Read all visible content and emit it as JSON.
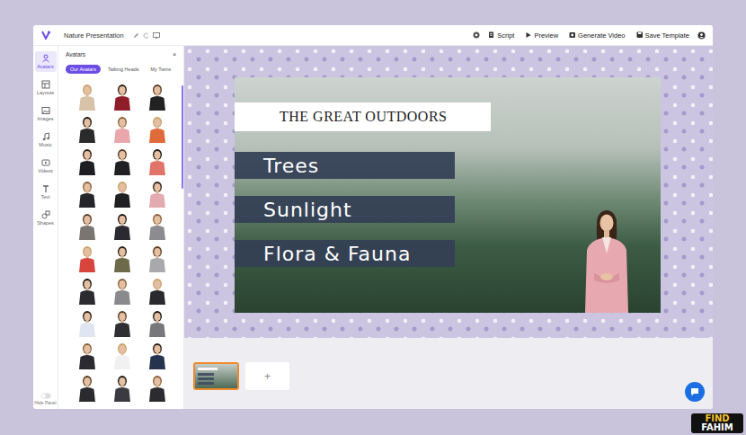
{
  "app": {
    "title": "Nature Presentation"
  },
  "toolbar": {
    "buttons": [
      "Script",
      "Preview",
      "Generate Video",
      "Save Template"
    ]
  },
  "rail": [
    {
      "label": "Avatars",
      "selected": true
    },
    {
      "label": "Layouts",
      "selected": false
    },
    {
      "label": "Images",
      "selected": false
    },
    {
      "label": "Music",
      "selected": false
    },
    {
      "label": "Videos",
      "selected": false
    },
    {
      "label": "Text",
      "selected": false
    },
    {
      "label": "Shapes",
      "selected": false
    }
  ],
  "rail_footer": "Hide Panel",
  "panel": {
    "title": "Avatars",
    "close": "×",
    "tabs": [
      {
        "label": "Our Avatars",
        "selected": true
      },
      {
        "label": "Talking Heads",
        "selected": false
      },
      {
        "label": "My Twins",
        "selected": false
      }
    ],
    "avatars": [
      {
        "color": "#d8c3a8"
      },
      {
        "color": "#8e1f2a"
      },
      {
        "color": "#222222"
      },
      {
        "color": "#2a2a2a"
      },
      {
        "color": "#e9a6ad"
      },
      {
        "color": "#e06b3a"
      },
      {
        "color": "#1e1e22"
      },
      {
        "color": "#202024"
      },
      {
        "color": "#e07468"
      },
      {
        "color": "#26262a"
      },
      {
        "color": "#1f1f23"
      },
      {
        "color": "#e3aab0"
      },
      {
        "color": "#7a7570"
      },
      {
        "color": "#2a2a30"
      },
      {
        "color": "#8c8c90"
      },
      {
        "color": "#d8453f"
      },
      {
        "color": "#6d6a4a"
      },
      {
        "color": "#a9a9ad"
      },
      {
        "color": "#2b2b30"
      },
      {
        "color": "#8a8a8e"
      },
      {
        "color": "#29292e"
      },
      {
        "color": "#dfe6f2"
      },
      {
        "color": "#2e2e33"
      },
      {
        "color": "#77777c"
      },
      {
        "color": "#2a2a30"
      },
      {
        "color": "#f1f1f1"
      },
      {
        "color": "#26334e"
      },
      {
        "color": "#2b2b2f"
      },
      {
        "color": "#3a3a40"
      },
      {
        "color": "#2c2c30"
      }
    ]
  },
  "slide": {
    "title": "THE GREAT OUTDOORS",
    "bullets": [
      "Trees",
      "Sunlight",
      "Flora & Fauna"
    ]
  },
  "slides": [
    {
      "selected": true
    }
  ],
  "add_slide": "+",
  "watermark": [
    "FIND",
    "FAHIM"
  ]
}
